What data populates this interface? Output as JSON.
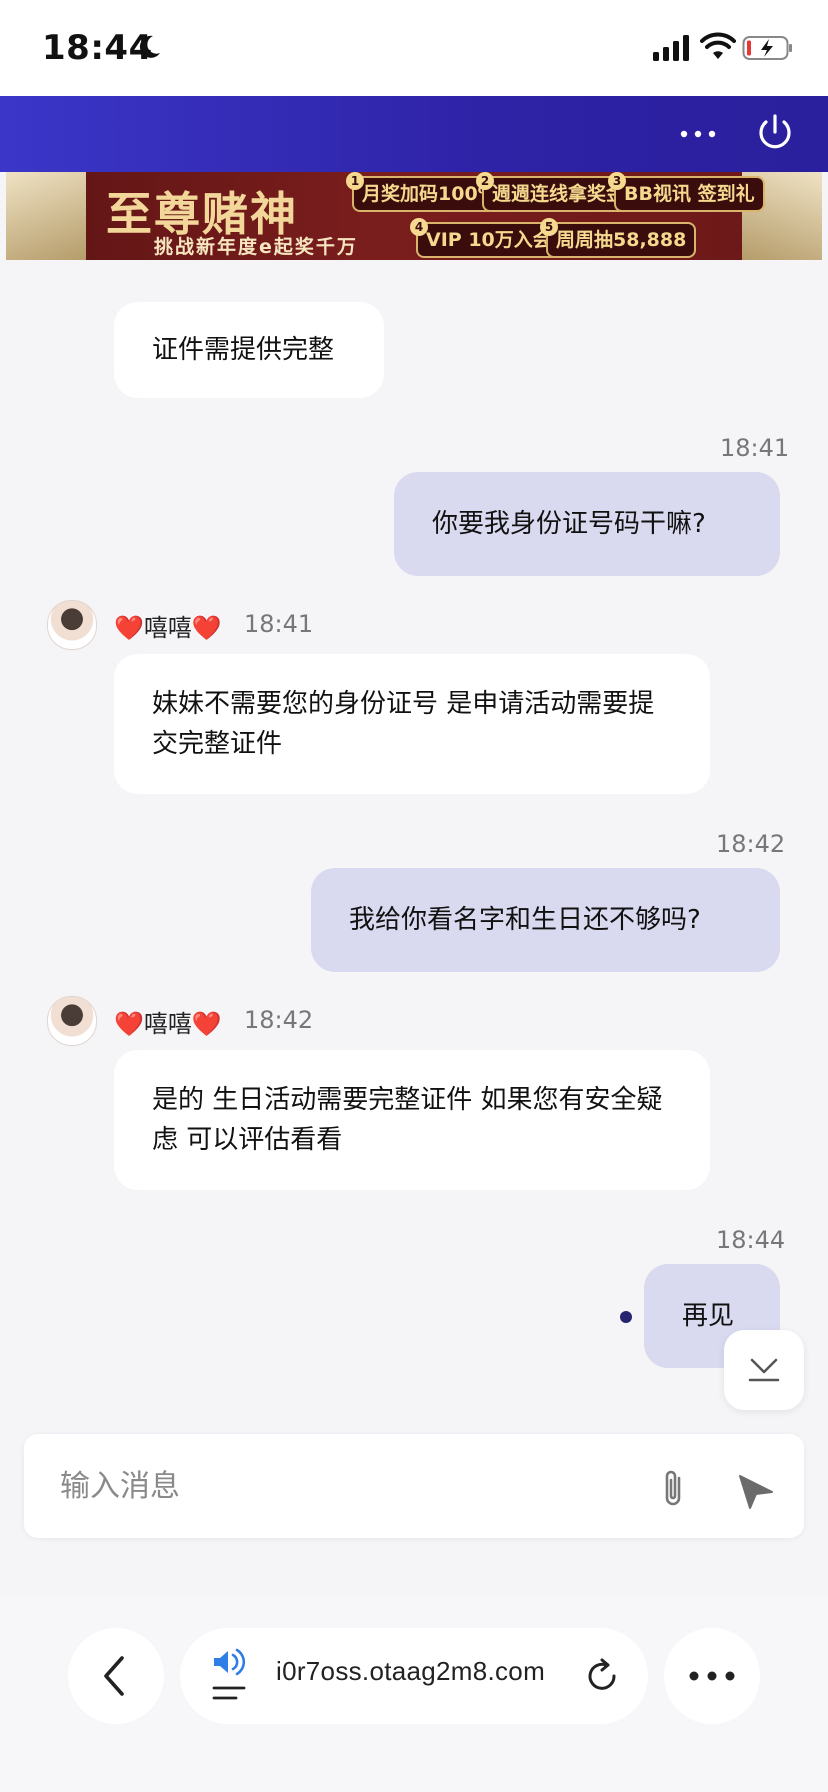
{
  "status": {
    "time": "18:44"
  },
  "banner": {
    "title": "至尊赌神",
    "subtitle": "挑战新年度e起奖千万",
    "promos": [
      {
        "num": "1",
        "text": "月奖加码100%"
      },
      {
        "num": "2",
        "text": "週週连线拿奖金"
      },
      {
        "num": "3",
        "text": "BB视讯 签到礼"
      },
      {
        "num": "4",
        "text": "VIP 10万入会"
      },
      {
        "num": "5",
        "text": "周周抽58,888"
      }
    ]
  },
  "chat": {
    "messages": [
      {
        "dir": "in",
        "text": "证件需提供完整"
      },
      {
        "dir": "out",
        "time": "18:41",
        "text": "你要我身份证号码干嘛?"
      },
      {
        "dir": "in",
        "sender": "❤️嘻嘻❤️",
        "time": "18:41",
        "text": "妹妹不需要您的身份证号 是申请活动需要提交完整证件"
      },
      {
        "dir": "out",
        "time": "18:42",
        "text": "我给你看名字和生日还不够吗?"
      },
      {
        "dir": "in",
        "sender": "❤️嘻嘻❤️",
        "time": "18:42",
        "text": "是的 生日活动需要完整证件 如果您有安全疑虑 可以评估看看"
      },
      {
        "dir": "out",
        "time": "18:44",
        "text": "再见"
      }
    ]
  },
  "input": {
    "placeholder": "输入消息",
    "value": ""
  },
  "browser": {
    "url": "i0r7oss.otaag2m8.com"
  },
  "icons": [
    "moon-icon",
    "signal-icon",
    "wifi-icon",
    "battery-icon",
    "more-icon",
    "power-icon",
    "scroll-down-icon",
    "attach-icon",
    "send-icon",
    "back-icon",
    "speaker-icon",
    "reload-icon",
    "more-dots-icon"
  ],
  "colors": {
    "header": "#3b36c8",
    "outgoing_bubble": "#d9d9f0",
    "incoming_bubble": "#ffffff",
    "background": "#f5f5f8"
  }
}
